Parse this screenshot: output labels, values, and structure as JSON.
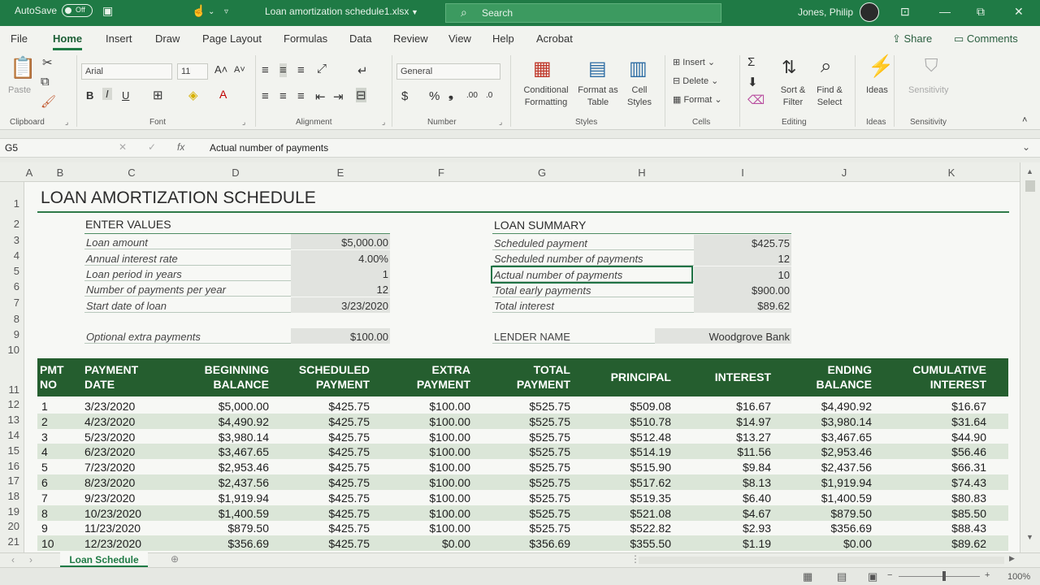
{
  "titlebar": {
    "autosave": "AutoSave",
    "autosave_state": "Off",
    "document": "Loan amortization schedule1.xlsx",
    "search": "Search",
    "user": "Jones, Philip"
  },
  "menu": [
    "File",
    "Home",
    "Insert",
    "Draw",
    "Page Layout",
    "Formulas",
    "Data",
    "Review",
    "View",
    "Help",
    "Acrobat"
  ],
  "share": "Share",
  "comments": "Comments",
  "ribbon": {
    "paste": "Paste",
    "font": "Arial",
    "size": "11",
    "number_format": "General",
    "conditional": [
      "Conditional",
      "Formatting"
    ],
    "format_table": [
      "Format as",
      "Table"
    ],
    "cell_styles": [
      "Cell",
      "Styles"
    ],
    "insert": "Insert",
    "delete": "Delete",
    "format": "Format",
    "sort": [
      "Sort &",
      "Filter"
    ],
    "find": [
      "Find &",
      "Select"
    ],
    "ideas": "Ideas",
    "sensitivity": "Sensitivity",
    "groups": {
      "clipboard": "Clipboard",
      "font": "Font",
      "alignment": "Alignment",
      "number": "Number",
      "styles": "Styles",
      "cells": "Cells",
      "editing": "Editing",
      "ideas": "Ideas",
      "sensitivity": "Sensitivity"
    }
  },
  "formula_bar": {
    "cell_ref": "G5",
    "fx": "fx",
    "formula": "Actual number of payments"
  },
  "columns": [
    "A",
    "B",
    "C",
    "D",
    "E",
    "F",
    "G",
    "H",
    "I",
    "J",
    "K"
  ],
  "rows": [
    "1",
    "2",
    "3",
    "4",
    "5",
    "6",
    "7",
    "8",
    "9",
    "10",
    "11",
    "12",
    "13",
    "14",
    "15",
    "16",
    "17",
    "18",
    "19",
    "20",
    "21"
  ],
  "sheet": {
    "title": "LOAN AMORTIZATION SCHEDULE",
    "enter_values": {
      "heading": "ENTER VALUES",
      "items": [
        {
          "label": "Loan amount",
          "value": "$5,000.00"
        },
        {
          "label": "Annual interest rate",
          "value": "4.00%"
        },
        {
          "label": "Loan period in years",
          "value": "1"
        },
        {
          "label": "Number of payments per year",
          "value": "12"
        },
        {
          "label": "Start date of loan",
          "value": "3/23/2020"
        }
      ],
      "extra": {
        "label": "Optional extra payments",
        "value": "$100.00"
      }
    },
    "summary": {
      "heading": "LOAN SUMMARY",
      "items": [
        {
          "label": "Scheduled payment",
          "value": "$425.75"
        },
        {
          "label": "Scheduled number of payments",
          "value": "12"
        },
        {
          "label": "Actual number of payments",
          "value": "10"
        },
        {
          "label": "Total early payments",
          "value": "$900.00"
        },
        {
          "label": "Total interest",
          "value": "$89.62"
        }
      ],
      "lender": {
        "label": "LENDER NAME",
        "value": "Woodgrove Bank"
      }
    },
    "table": {
      "headers": [
        [
          "PMT",
          "NO"
        ],
        [
          "PAYMENT",
          "DATE"
        ],
        [
          "BEGINNING",
          "BALANCE"
        ],
        [
          "SCHEDULED",
          "PAYMENT"
        ],
        [
          "EXTRA",
          "PAYMENT"
        ],
        [
          "TOTAL",
          "PAYMENT"
        ],
        [
          "PRINCIPAL",
          ""
        ],
        [
          "INTEREST",
          ""
        ],
        [
          "ENDING",
          "BALANCE"
        ],
        [
          "CUMULATIVE",
          "INTEREST"
        ]
      ],
      "rows": [
        [
          "1",
          "3/23/2020",
          "$5,000.00",
          "$425.75",
          "$100.00",
          "$525.75",
          "$509.08",
          "$16.67",
          "$4,490.92",
          "$16.67"
        ],
        [
          "2",
          "4/23/2020",
          "$4,490.92",
          "$425.75",
          "$100.00",
          "$525.75",
          "$510.78",
          "$14.97",
          "$3,980.14",
          "$31.64"
        ],
        [
          "3",
          "5/23/2020",
          "$3,980.14",
          "$425.75",
          "$100.00",
          "$525.75",
          "$512.48",
          "$13.27",
          "$3,467.65",
          "$44.90"
        ],
        [
          "4",
          "6/23/2020",
          "$3,467.65",
          "$425.75",
          "$100.00",
          "$525.75",
          "$514.19",
          "$11.56",
          "$2,953.46",
          "$56.46"
        ],
        [
          "5",
          "7/23/2020",
          "$2,953.46",
          "$425.75",
          "$100.00",
          "$525.75",
          "$515.90",
          "$9.84",
          "$2,437.56",
          "$66.31"
        ],
        [
          "6",
          "8/23/2020",
          "$2,437.56",
          "$425.75",
          "$100.00",
          "$525.75",
          "$517.62",
          "$8.13",
          "$1,919.94",
          "$74.43"
        ],
        [
          "7",
          "9/23/2020",
          "$1,919.94",
          "$425.75",
          "$100.00",
          "$525.75",
          "$519.35",
          "$6.40",
          "$1,400.59",
          "$80.83"
        ],
        [
          "8",
          "10/23/2020",
          "$1,400.59",
          "$425.75",
          "$100.00",
          "$525.75",
          "$521.08",
          "$4.67",
          "$879.50",
          "$85.50"
        ],
        [
          "9",
          "11/23/2020",
          "$879.50",
          "$425.75",
          "$100.00",
          "$525.75",
          "$522.82",
          "$2.93",
          "$356.69",
          "$88.43"
        ],
        [
          "10",
          "12/23/2020",
          "$356.69",
          "$425.75",
          "$0.00",
          "$356.69",
          "$355.50",
          "$1.19",
          "$0.00",
          "$89.62"
        ]
      ]
    }
  },
  "sheet_tab": "Loan Schedule",
  "zoom": "100%",
  "colors": {
    "excel_green": "#1f7a45",
    "header_green": "#255e2f",
    "band": "#dbe6d8"
  }
}
